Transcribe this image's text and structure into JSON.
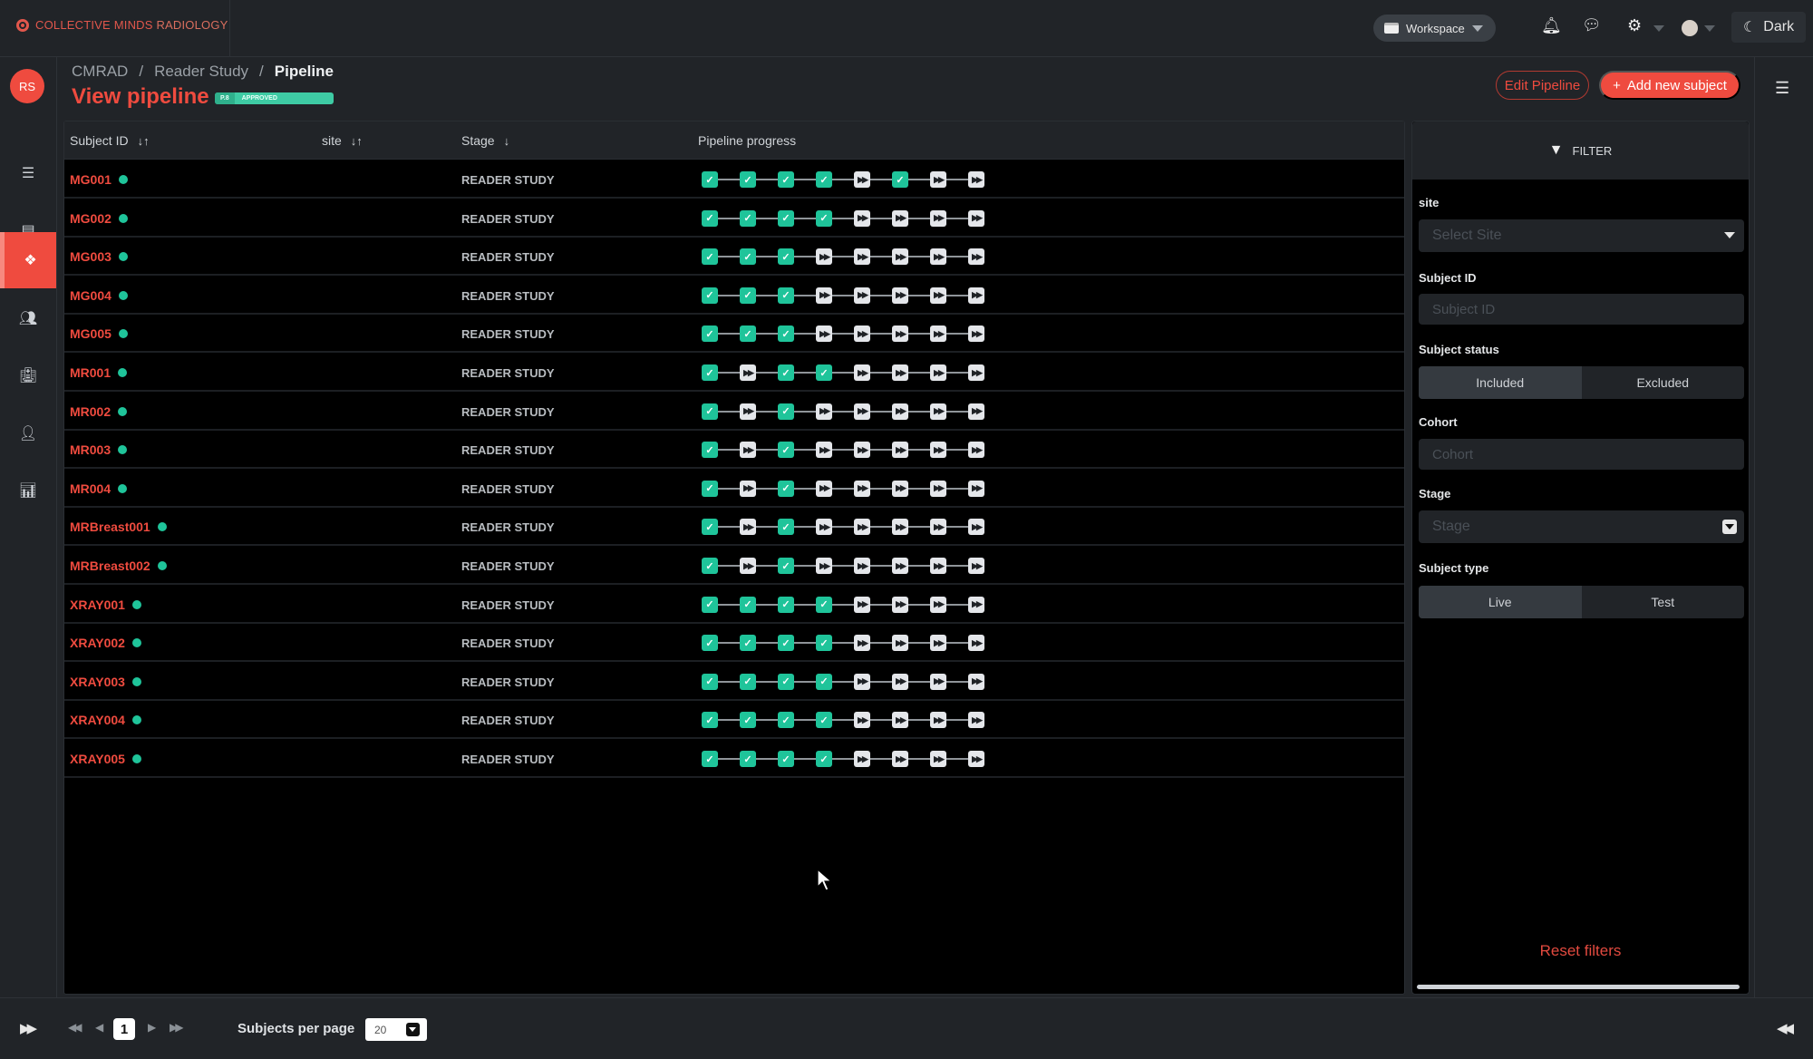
{
  "app": {
    "brand_part1": "COLLECTIVE MINDS",
    "brand_part2": "RADIOLOGY",
    "workspace_label": "Workspace",
    "theme_label": "Dark"
  },
  "user": {
    "initials": "RS"
  },
  "sidebar": {
    "items": [
      {
        "icon": "list-icon",
        "active": false
      },
      {
        "icon": "projects-icon",
        "active": false
      },
      {
        "icon": "pipeline-icon",
        "active": true
      },
      {
        "icon": "users-icon",
        "active": false
      },
      {
        "icon": "hospital-icon",
        "active": false
      },
      {
        "icon": "doctor-icon",
        "active": false
      },
      {
        "icon": "chart-icon",
        "active": false
      }
    ]
  },
  "header": {
    "breadcrumb": [
      "CMRAD",
      "Reader Study",
      "Pipeline"
    ],
    "title": "View pipeline",
    "badge_version": "P.8",
    "badge_status": "APPROVED",
    "edit_button": "Edit Pipeline",
    "add_button": "Add new subject"
  },
  "table": {
    "columns": [
      "Subject ID",
      "site",
      "Stage",
      "Pipeline progress"
    ],
    "rows": [
      {
        "id": "MG001",
        "site": "",
        "stage": "READER STUDY",
        "steps": [
          1,
          1,
          1,
          1,
          0,
          1,
          0,
          0
        ]
      },
      {
        "id": "MG002",
        "site": "",
        "stage": "READER STUDY",
        "steps": [
          1,
          1,
          1,
          1,
          0,
          0,
          0,
          0
        ]
      },
      {
        "id": "MG003",
        "site": "",
        "stage": "READER STUDY",
        "steps": [
          1,
          1,
          1,
          0,
          0,
          0,
          0,
          0
        ]
      },
      {
        "id": "MG004",
        "site": "",
        "stage": "READER STUDY",
        "steps": [
          1,
          1,
          1,
          0,
          0,
          0,
          0,
          0
        ]
      },
      {
        "id": "MG005",
        "site": "",
        "stage": "READER STUDY",
        "steps": [
          1,
          1,
          1,
          0,
          0,
          0,
          0,
          0
        ]
      },
      {
        "id": "MR001",
        "site": "",
        "stage": "READER STUDY",
        "steps": [
          1,
          0,
          1,
          1,
          0,
          0,
          0,
          0
        ]
      },
      {
        "id": "MR002",
        "site": "",
        "stage": "READER STUDY",
        "steps": [
          1,
          0,
          1,
          0,
          0,
          0,
          0,
          0
        ]
      },
      {
        "id": "MR003",
        "site": "",
        "stage": "READER STUDY",
        "steps": [
          1,
          0,
          1,
          0,
          0,
          0,
          0,
          0
        ]
      },
      {
        "id": "MR004",
        "site": "",
        "stage": "READER STUDY",
        "steps": [
          1,
          0,
          1,
          0,
          0,
          0,
          0,
          0
        ]
      },
      {
        "id": "MRBreast001",
        "site": "",
        "stage": "READER STUDY",
        "steps": [
          1,
          0,
          1,
          0,
          0,
          0,
          0,
          0
        ]
      },
      {
        "id": "MRBreast002",
        "site": "",
        "stage": "READER STUDY",
        "steps": [
          1,
          0,
          1,
          0,
          0,
          0,
          0,
          0
        ]
      },
      {
        "id": "XRAY001",
        "site": "",
        "stage": "READER STUDY",
        "steps": [
          1,
          1,
          1,
          1,
          0,
          0,
          0,
          0
        ]
      },
      {
        "id": "XRAY002",
        "site": "",
        "stage": "READER STUDY",
        "steps": [
          1,
          1,
          1,
          1,
          0,
          0,
          0,
          0
        ]
      },
      {
        "id": "XRAY003",
        "site": "",
        "stage": "READER STUDY",
        "steps": [
          1,
          1,
          1,
          1,
          0,
          0,
          0,
          0
        ]
      },
      {
        "id": "XRAY004",
        "site": "",
        "stage": "READER STUDY",
        "steps": [
          1,
          1,
          1,
          1,
          0,
          0,
          0,
          0
        ]
      },
      {
        "id": "XRAY005",
        "site": "",
        "stage": "READER STUDY",
        "steps": [
          1,
          1,
          1,
          1,
          0,
          0,
          0,
          0
        ]
      }
    ]
  },
  "filter": {
    "title": "FILTER",
    "site_label": "site",
    "site_placeholder": "Select Site",
    "subject_id_label": "Subject ID",
    "subject_id_placeholder": "Subject ID",
    "status_label": "Subject status",
    "status_options": [
      "Included",
      "Excluded"
    ],
    "status_selected": "Included",
    "cohort_label": "Cohort",
    "cohort_placeholder": "Cohort",
    "stage_label": "Stage",
    "stage_placeholder": "Stage",
    "type_label": "Subject type",
    "type_options": [
      "Live",
      "Test"
    ],
    "type_selected": "Live",
    "reset_label": "Reset filters"
  },
  "pagination": {
    "current_page": "1",
    "per_page_label": "Subjects per page",
    "per_page_value": "20"
  },
  "colors": {
    "accent": "#ef4b3f",
    "success": "#1fc49a",
    "background": "#212428",
    "panel": "#000000"
  }
}
